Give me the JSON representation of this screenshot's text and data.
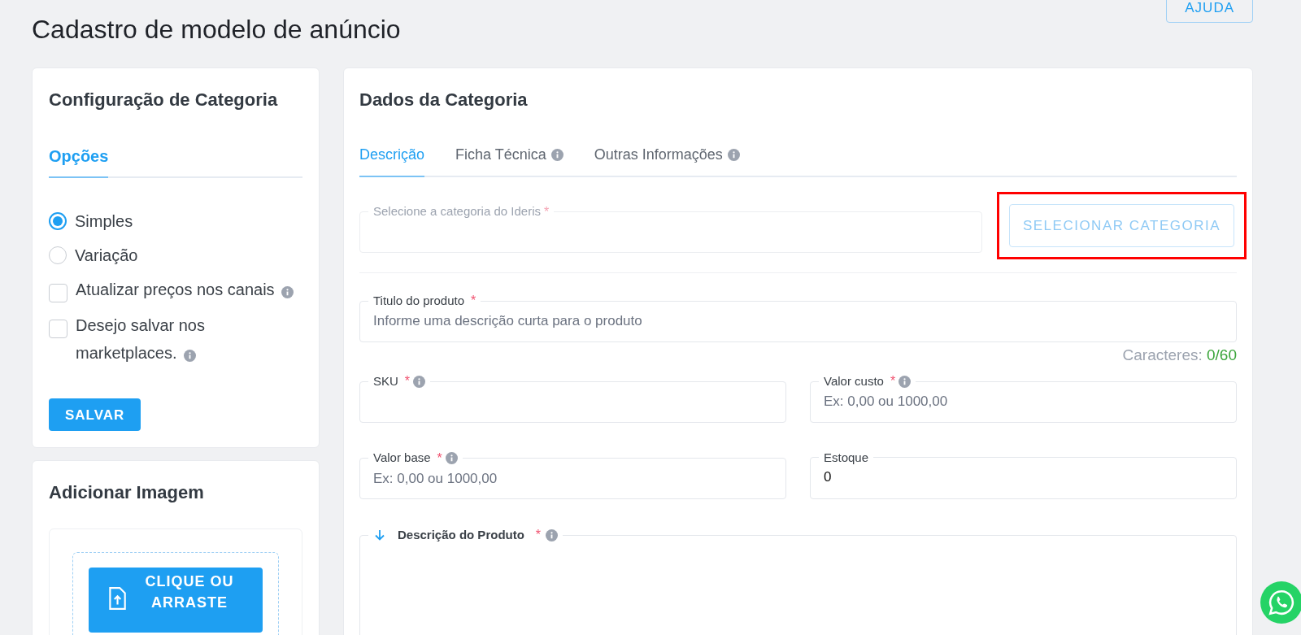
{
  "page": {
    "title": "Cadastro de modelo de anúncio",
    "help_button": "AJUDA"
  },
  "config_card": {
    "title": "Configuração de Categoria",
    "tab": {
      "label": "Opções",
      "selected": true
    },
    "options": [
      {
        "kind": "radio",
        "label": "Simples",
        "checked": true,
        "info": false
      },
      {
        "kind": "radio",
        "label": "Variação",
        "checked": false,
        "info": false
      },
      {
        "kind": "checkbox",
        "label": "Atualizar preços nos canais",
        "checked": false,
        "info": true
      },
      {
        "kind": "checkbox",
        "label": "Desejo salvar nos marketplaces.",
        "checked": false,
        "info": true
      }
    ],
    "save_button": "SALVAR"
  },
  "image_card": {
    "title": "Adicionar Imagem",
    "upload_button": "CLIQUE OU ARRASTE"
  },
  "data_card": {
    "title": "Dados da Categoria",
    "tabs": [
      {
        "label": "Descrição",
        "selected": true,
        "info": false
      },
      {
        "label": "Ficha Técnica",
        "selected": false,
        "info": true
      },
      {
        "label": "Outras Informações",
        "selected": false,
        "info": true
      }
    ],
    "category_field": {
      "label": "Selecione a categoria do Ideris",
      "required_mark": "*"
    },
    "select_button": {
      "label": "SELECIONAR CATEGORIA",
      "highlighted": true
    },
    "title_field": {
      "label": "Titulo do produto",
      "required_mark": "*",
      "info": false,
      "placeholder": "Informe uma descrição curta para o produto"
    },
    "char_count": {
      "label": "Caracteres:",
      "value": "0/60"
    },
    "fields": [
      {
        "label": "SKU",
        "required_mark": "*",
        "info": true
      },
      {
        "label": "Valor custo",
        "required_mark": "*",
        "info": true,
        "placeholder": "Ex: 0,00 ou 1000,00"
      },
      {
        "label": "Valor base",
        "required_mark": "*",
        "info": true,
        "placeholder": "Ex: 0,00 ou 1000,00"
      },
      {
        "label": "Estoque",
        "info": false,
        "value": "0"
      }
    ],
    "description_field": {
      "label": "Descrição do Produto",
      "required_mark": "*",
      "info": true
    }
  }
}
